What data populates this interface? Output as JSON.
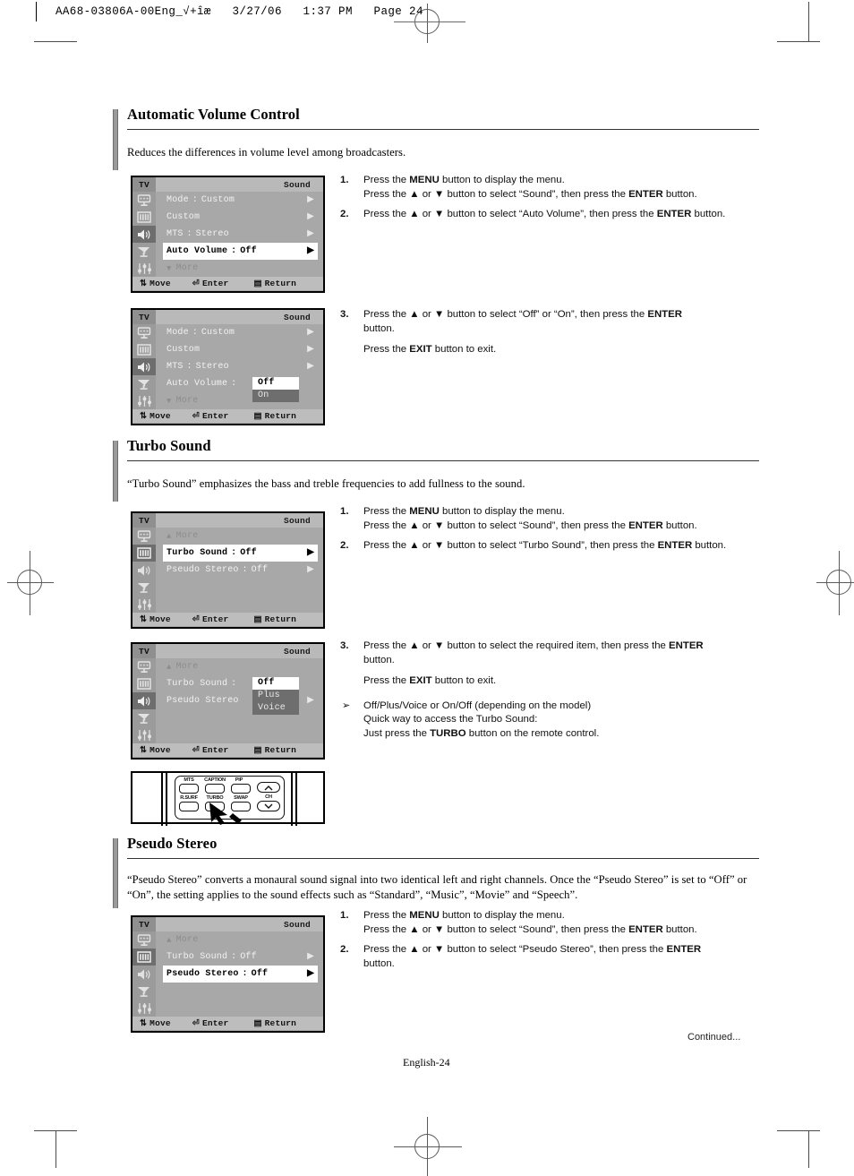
{
  "print_slug": "AA68-03806A-00Eng_√+îæ   3/27/06   1:37 PM   Page 24",
  "sections": [
    {
      "id": "automatic-volume-control",
      "title": "Automatic Volume Control",
      "description": "Reduces the differences in volume level among broadcasters."
    },
    {
      "id": "turbo-sound",
      "title": "Turbo Sound",
      "description": "“Turbo Sound” emphasizes the bass and treble frequencies to add fullness to the sound."
    },
    {
      "id": "pseudo-stereo",
      "title": "Pseudo Stereo",
      "description": "“Pseudo Stereo” converts a monaural sound signal into two identical left and right channels. Once the “Pseudo Stereo” is set to “Off” or “On”, the setting applies to the sound effects such as “Standard”, “Music”, “Movie” and “Speech”."
    }
  ],
  "osd_common": {
    "device_label": "TV",
    "menu_title": "Sound",
    "footer": {
      "move": "Move",
      "enter": "Enter",
      "return": "Return"
    },
    "rail_icons": [
      "tv-input-icon",
      "picture-bars-icon",
      "speaker-icon",
      "satellite-dish-icon",
      "setup-sliders-icon"
    ]
  },
  "osd_screens": [
    {
      "id": "avc-menu-1",
      "active_rail_index": 2,
      "rows": [
        {
          "label": "Mode",
          "colon": ":",
          "value": "Custom",
          "arrow": true,
          "selected": false,
          "dim": false
        },
        {
          "label": "Custom",
          "colon": "",
          "value": "",
          "arrow": true,
          "selected": false,
          "dim": false
        },
        {
          "label": "MTS",
          "colon": ":",
          "value": "Stereo",
          "arrow": true,
          "selected": false,
          "dim": false
        },
        {
          "label": "Auto Volume",
          "colon": ":",
          "value": "Off",
          "arrow": true,
          "selected": true,
          "dim": false
        },
        {
          "label": "More",
          "colon": "",
          "value": "",
          "arrow": false,
          "selected": false,
          "dim": true,
          "tri": "down"
        }
      ],
      "popup": null
    },
    {
      "id": "avc-menu-2",
      "active_rail_index": 2,
      "rows": [
        {
          "label": "Mode",
          "colon": ":",
          "value": "Custom",
          "arrow": true,
          "selected": false,
          "dim": false
        },
        {
          "label": "Custom",
          "colon": "",
          "value": "",
          "arrow": true,
          "selected": false,
          "dim": false
        },
        {
          "label": "MTS",
          "colon": ":",
          "value": "Stereo",
          "arrow": true,
          "selected": false,
          "dim": false
        },
        {
          "label": "Auto Volume",
          "colon": ":",
          "value": "",
          "arrow": false,
          "selected": false,
          "dim": false
        },
        {
          "label": "More",
          "colon": "",
          "value": "",
          "arrow": false,
          "selected": false,
          "dim": true,
          "tri": "down"
        }
      ],
      "popup": {
        "row": 3,
        "current_index": 0,
        "options": [
          "Off",
          "On"
        ]
      }
    },
    {
      "id": "turbo-menu-1",
      "active_rail_index": 1,
      "rows": [
        {
          "label": "More",
          "colon": "",
          "value": "",
          "arrow": false,
          "selected": false,
          "dim": true,
          "tri": "up"
        },
        {
          "label": "Turbo Sound",
          "colon": ":",
          "value": "Off",
          "arrow": true,
          "selected": true,
          "dim": false
        },
        {
          "label": "Pseudo Stereo",
          "colon": ":",
          "value": "Off",
          "arrow": true,
          "selected": false,
          "dim": false
        },
        {
          "label": "",
          "colon": "",
          "value": "",
          "arrow": false,
          "selected": false,
          "dim": false
        },
        {
          "label": "",
          "colon": "",
          "value": "",
          "arrow": false,
          "selected": false,
          "dim": false
        }
      ],
      "popup": null
    },
    {
      "id": "turbo-menu-2",
      "active_rail_index": 2,
      "rows": [
        {
          "label": "More",
          "colon": "",
          "value": "",
          "arrow": false,
          "selected": false,
          "dim": true,
          "tri": "up"
        },
        {
          "label": "Turbo Sound",
          "colon": ":",
          "value": "",
          "arrow": false,
          "selected": false,
          "dim": false
        },
        {
          "label": "Pseudo Stereo",
          "colon": "",
          "value": "",
          "arrow": true,
          "selected": false,
          "dim": false
        },
        {
          "label": "",
          "colon": "",
          "value": "",
          "arrow": false,
          "selected": false,
          "dim": false
        },
        {
          "label": "",
          "colon": "",
          "value": "",
          "arrow": false,
          "selected": false,
          "dim": false
        }
      ],
      "popup": {
        "row": 1,
        "current_index": 0,
        "options": [
          "Off",
          "Plus",
          "Voice"
        ]
      }
    },
    {
      "id": "pseudo-menu-1",
      "active_rail_index": 1,
      "rows": [
        {
          "label": "More",
          "colon": "",
          "value": "",
          "arrow": false,
          "selected": false,
          "dim": true,
          "tri": "up"
        },
        {
          "label": "Turbo Sound",
          "colon": ":",
          "value": "Off",
          "arrow": true,
          "selected": false,
          "dim": false
        },
        {
          "label": "Pseudo Stereo",
          "colon": ":",
          "value": "Off",
          "arrow": true,
          "selected": true,
          "dim": false
        },
        {
          "label": "",
          "colon": "",
          "value": "",
          "arrow": false,
          "selected": false,
          "dim": false
        },
        {
          "label": "",
          "colon": "",
          "value": "",
          "arrow": false,
          "selected": false,
          "dim": false
        }
      ],
      "popup": null
    }
  ],
  "instructions": {
    "avc_a": {
      "steps": [
        {
          "num": "1.",
          "lines": [
            "Press the |MENU| button to display the menu.",
            "Press the ▲ or ▼ button to select “Sound”, then press the |ENTER| button."
          ]
        },
        {
          "num": "2.",
          "lines": [
            "Press the ▲ or ▼ button to select “Auto Volume”, then press the |ENTER| button."
          ]
        }
      ]
    },
    "avc_b": {
      "steps": [
        {
          "num": "3.",
          "lines": [
            "Press the ▲ or ▼ button to select “Off” or “On”, then press the |ENTER|",
            "button."
          ],
          "sub": "Press the |EXIT| button to exit."
        }
      ]
    },
    "turbo_a": {
      "steps": [
        {
          "num": "1.",
          "lines": [
            "Press the |MENU| button to display the menu.",
            "Press the ▲ or ▼ button to select “Sound”, then press the |ENTER| button."
          ]
        },
        {
          "num": "2.",
          "lines": [
            "Press the ▲ or ▼ button to select “Turbo Sound”, then press the |ENTER| button."
          ]
        }
      ]
    },
    "turbo_b": {
      "steps": [
        {
          "num": "3.",
          "lines": [
            "Press the ▲ or ▼ button to select the required item, then press the |ENTER|",
            "button."
          ],
          "sub": "Press the |EXIT| button to exit."
        }
      ],
      "note": [
        "Off/Plus/Voice or On/Off (depending on the model)",
        "Quick way to access the Turbo Sound:",
        "Just press the |TURBO| button on the remote control."
      ]
    },
    "pseudo_a": {
      "steps": [
        {
          "num": "1.",
          "lines": [
            "Press the |MENU| button to display the menu.",
            "Press the ▲ or ▼ button to select “Sound”, then press the |ENTER| button."
          ]
        },
        {
          "num": "2.",
          "lines": [
            "Press the ▲ or ▼ button to select “Pseudo Stereo”, then press the |ENTER|",
            "button."
          ]
        }
      ]
    }
  },
  "remote": {
    "keys_row1": [
      "MTS",
      "CAPTION",
      "PIP"
    ],
    "keys_row2": [
      "R.SURF",
      "TURBO",
      "SWAP"
    ],
    "ch_label": "CH",
    "ch_up_icon": "chevron-up-icon",
    "ch_down_icon": "chevron-down-icon",
    "pointer_icon": "hand-pointer-icon"
  },
  "footer": {
    "page_label": "English-24",
    "continued": "Continued..."
  }
}
